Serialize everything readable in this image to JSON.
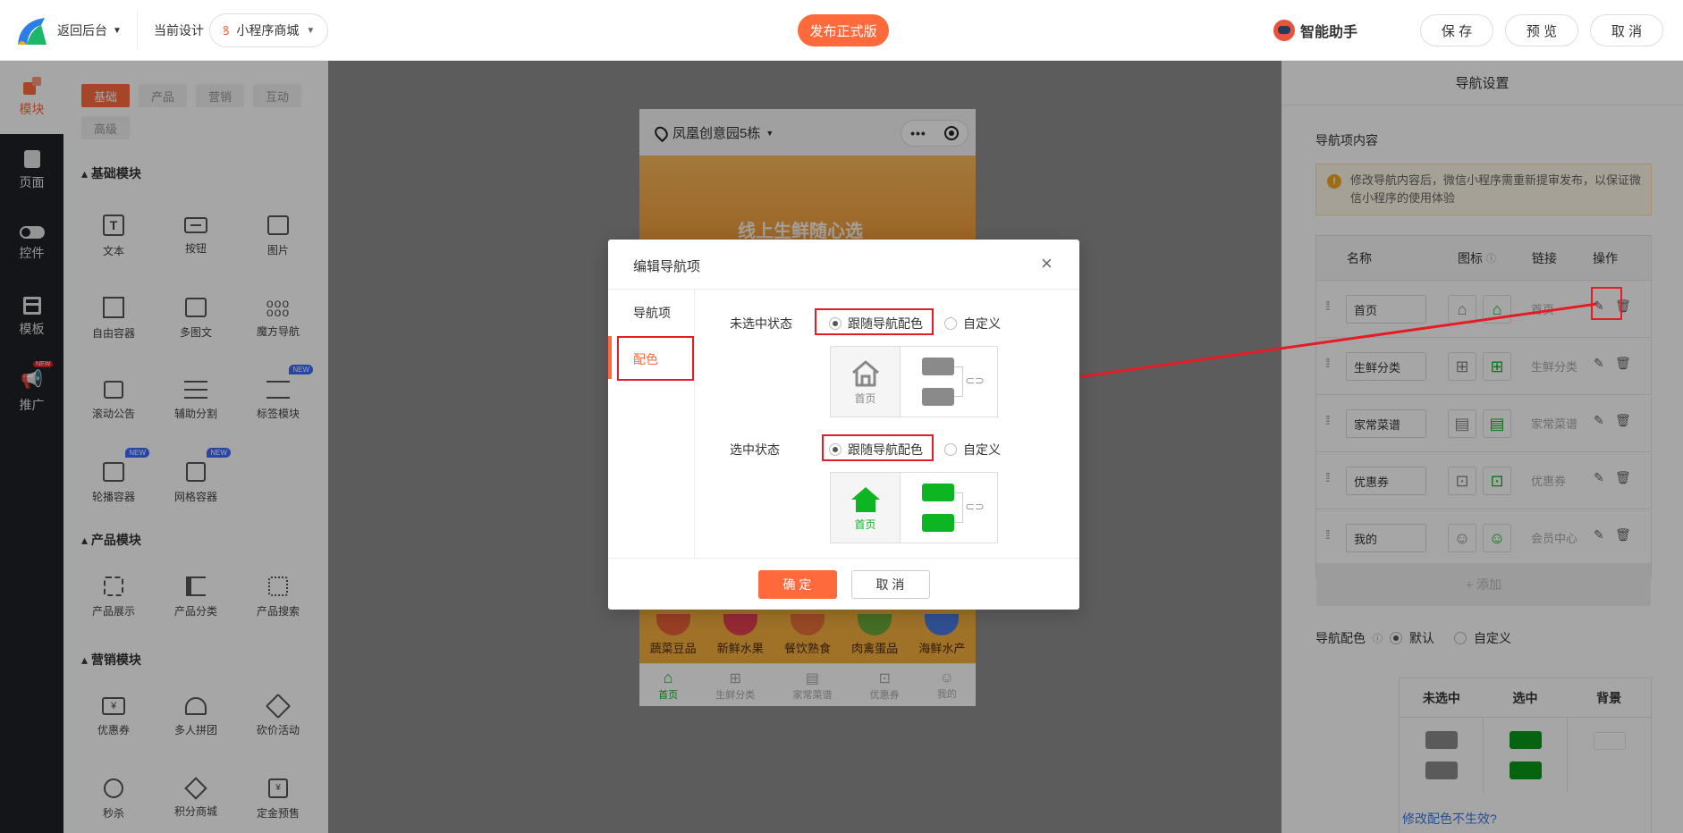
{
  "topbar": {
    "back_label": "返回后台",
    "current_design_label": "当前设计",
    "design_select": "小程序商城",
    "publish_label": "发布正式版",
    "assistant_label": "智能助手",
    "save_label": "保 存",
    "preview_label": "预 览",
    "cancel_label": "取 消"
  },
  "sidenav": {
    "items": [
      {
        "label": "模块",
        "icon": "blocks-icon"
      },
      {
        "label": "页面",
        "icon": "page-icon"
      },
      {
        "label": "控件",
        "icon": "toggle-icon"
      },
      {
        "label": "模板",
        "icon": "template-icon"
      },
      {
        "label": "推广",
        "icon": "megaphone-icon",
        "badge": "NEW"
      }
    ]
  },
  "modpanel": {
    "tabs": [
      "基础",
      "产品",
      "营销",
      "互动",
      "高级"
    ],
    "sections": [
      {
        "title": "基础模块",
        "items": [
          {
            "label": "文本"
          },
          {
            "label": "按钮"
          },
          {
            "label": "图片"
          },
          {
            "label": "自由容器"
          },
          {
            "label": "多图文"
          },
          {
            "label": "魔方导航"
          },
          {
            "label": "滚动公告"
          },
          {
            "label": "辅助分割"
          },
          {
            "label": "标签模块",
            "badge": "NEW"
          },
          {
            "label": "轮播容器",
            "badge": "NEW"
          },
          {
            "label": "网格容器",
            "badge": "NEW"
          }
        ]
      },
      {
        "title": "产品模块",
        "items": [
          {
            "label": "产品展示"
          },
          {
            "label": "产品分类"
          },
          {
            "label": "产品搜索"
          }
        ]
      },
      {
        "title": "营销模块",
        "items": [
          {
            "label": "优惠券"
          },
          {
            "label": "多人拼团"
          },
          {
            "label": "砍价活动"
          },
          {
            "label": "秒杀"
          },
          {
            "label": "积分商城"
          },
          {
            "label": "定金预售"
          }
        ]
      }
    ]
  },
  "phone": {
    "location": "凤凰创意园5栋",
    "banner_text": "线上生鲜随心选",
    "categories": [
      "蔬菜豆品",
      "新鲜水果",
      "餐饮熟食",
      "肉禽蛋品",
      "海鲜水产"
    ],
    "tabbar": [
      {
        "label": "首页",
        "icon": "home-icon",
        "active": true
      },
      {
        "label": "生鲜分类",
        "icon": "category-icon"
      },
      {
        "label": "家常菜谱",
        "icon": "clipboard-icon"
      },
      {
        "label": "优惠券",
        "icon": "gift-icon"
      },
      {
        "label": "我的",
        "icon": "user-icon"
      }
    ]
  },
  "rightpanel": {
    "title": "导航设置",
    "section_label": "导航项内容",
    "warning": "修改导航内容后，微信小程序需重新提审发布，以保证微信小程序的使用体验",
    "table_headers": [
      "名称",
      "图标",
      "链接",
      "操作"
    ],
    "rows": [
      {
        "name": "首页",
        "link": "首页",
        "icon": "home-icon"
      },
      {
        "name": "生鲜分类",
        "link": "生鲜分类",
        "icon": "category-icon"
      },
      {
        "name": "家常菜谱",
        "link": "家常菜谱",
        "icon": "clipboard-icon"
      },
      {
        "name": "优惠券",
        "link": "优惠券",
        "icon": "gift-icon"
      },
      {
        "name": "我的",
        "link": "会员中心",
        "icon": "user-icon"
      }
    ],
    "add_label": "+ 添加",
    "color_label": "导航配色",
    "color_default": "默认",
    "color_custom": "自定义",
    "color_headers": [
      "未选中",
      "选中",
      "背景"
    ],
    "color_help": "修改配色不生效?"
  },
  "modal": {
    "title": "编辑导航项",
    "menu": [
      "导航项",
      "配色"
    ],
    "unselected_label": "未选中状态",
    "selected_label": "选中状态",
    "follow_label": "跟随导航配色",
    "custom_label": "自定义",
    "preview_label": "首页",
    "confirm_label": "确 定",
    "cancel_label": "取 消"
  },
  "colors": {
    "accent": "#ff6a3d",
    "green": "#0db522",
    "gray": "#8a8a8a",
    "red_annotation": "#e51c23"
  }
}
